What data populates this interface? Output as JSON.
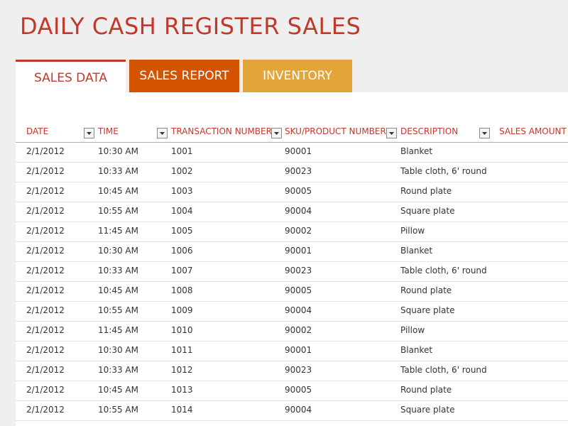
{
  "page": {
    "title": "DAILY CASH REGISTER SALES"
  },
  "tabs": [
    {
      "label": "SALES DATA"
    },
    {
      "label": "SALES REPORT"
    },
    {
      "label": "INVENTORY"
    }
  ],
  "table": {
    "columns": [
      "DATE",
      "TIME",
      "TRANSACTION NUMBER",
      "SKU/PRODUCT NUMBER",
      "DESCRIPTION",
      "SALES AMOUNT"
    ],
    "rows": [
      [
        "2/1/2012",
        "10:30 AM",
        "1001",
        "90001",
        "Blanket"
      ],
      [
        "2/1/2012",
        "10:33 AM",
        "1002",
        "90023",
        "Table cloth, 6' round"
      ],
      [
        "2/1/2012",
        "10:45 AM",
        "1003",
        "90005",
        "Round plate"
      ],
      [
        "2/1/2012",
        "10:55 AM",
        "1004",
        "90004",
        "Square plate"
      ],
      [
        "2/1/2012",
        "11:45 AM",
        "1005",
        "90002",
        "Pillow"
      ],
      [
        "2/1/2012",
        "10:30 AM",
        "1006",
        "90001",
        "Blanket"
      ],
      [
        "2/1/2012",
        "10:33 AM",
        "1007",
        "90023",
        "Table cloth, 6' round"
      ],
      [
        "2/1/2012",
        "10:45 AM",
        "1008",
        "90005",
        "Round plate"
      ],
      [
        "2/1/2012",
        "10:55 AM",
        "1009",
        "90004",
        "Square plate"
      ],
      [
        "2/1/2012",
        "11:45 AM",
        "1010",
        "90002",
        "Pillow"
      ],
      [
        "2/1/2012",
        "10:30 AM",
        "1011",
        "90001",
        "Blanket"
      ],
      [
        "2/1/2012",
        "10:33 AM",
        "1012",
        "90023",
        "Table cloth, 6' round"
      ],
      [
        "2/1/2012",
        "10:45 AM",
        "1013",
        "90005",
        "Round plate"
      ],
      [
        "2/1/2012",
        "10:55 AM",
        "1014",
        "90004",
        "Square plate"
      ]
    ]
  },
  "icons": {
    "filter": "dropdown-arrow-icon"
  },
  "colors": {
    "title": "#c0392b",
    "tab_sales_report": "#d35400",
    "tab_inventory": "#e3a53a"
  }
}
